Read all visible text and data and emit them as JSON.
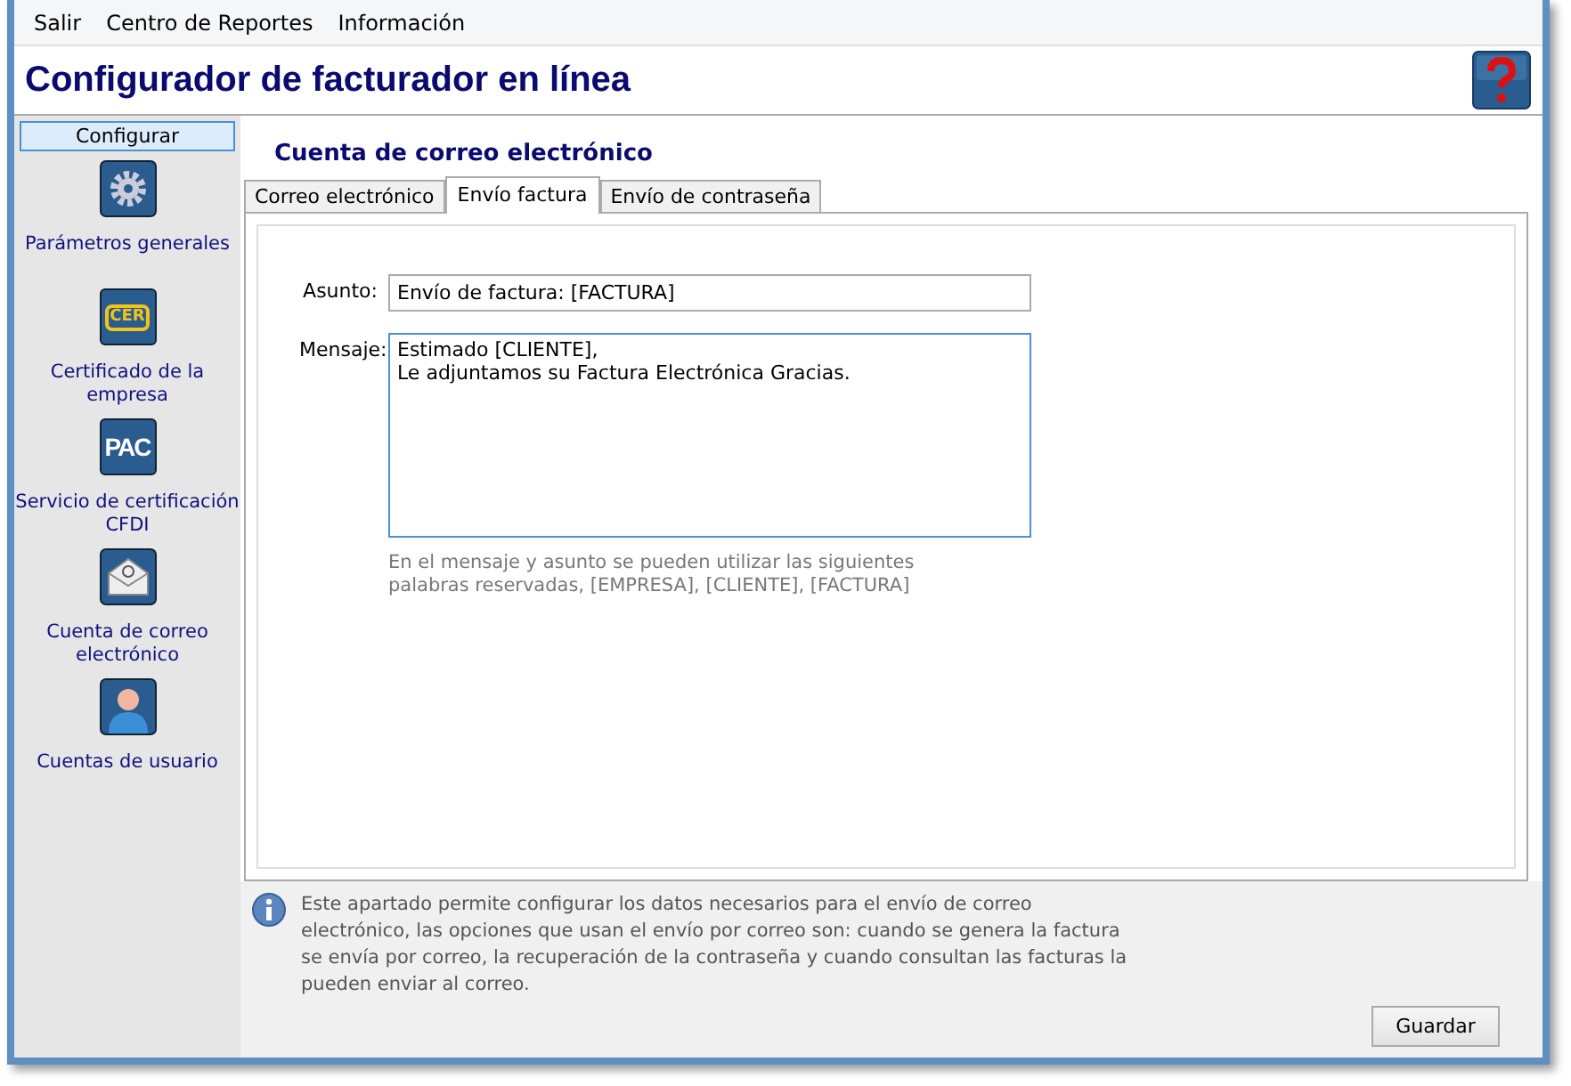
{
  "menu": [
    "Salir",
    "Centro de Reportes",
    "Información"
  ],
  "title": "Configurador de facturador en línea",
  "sidebar": {
    "header": "Configurar",
    "items": [
      {
        "kind": "gear",
        "label": "Parámetros generales"
      },
      {
        "kind": "cer",
        "badge": "CER",
        "label": "Certificado de la empresa"
      },
      {
        "kind": "pac",
        "badge": "PAC",
        "label": "Servicio de certificación CFDI"
      },
      {
        "kind": "mail",
        "label": "Cuenta de correo electrónico"
      },
      {
        "kind": "user",
        "label": "Cuentas de usuario"
      }
    ]
  },
  "section_title": "Cuenta de correo electrónico",
  "tabs": [
    {
      "label": "Correo electrónico",
      "selected": false
    },
    {
      "label": "Envío factura",
      "selected": true
    },
    {
      "label": "Envío de contraseña",
      "selected": false
    }
  ],
  "form": {
    "subject_label": "Asunto:",
    "subject": "Envío de factura: [FACTURA]",
    "message_label": "Mensaje:",
    "message": "Estimado [CLIENTE],\nLe adjuntamos su Factura Electrónica Gracias.",
    "hint": "En el mensaje y asunto se pueden utilizar las siguientes palabras reservadas, [EMPRESA], [CLIENTE], [FACTURA]"
  },
  "info": "Este apartado permite configurar los datos necesarios para el envío de correo electrónico, las opciones que usan el envío por correo son: cuando se genera la factura se envía por correo, la recuperación de la contraseña y cuando consultan las facturas la pueden enviar al correo.",
  "save_button": "Guardar"
}
